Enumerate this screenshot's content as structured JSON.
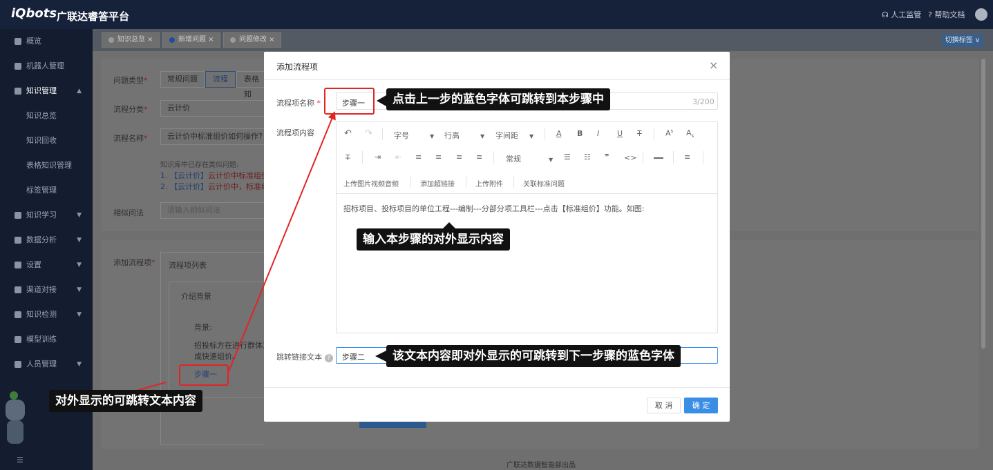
{
  "header": {
    "logo": "iQbots",
    "title": "广联达睿答平台",
    "monitor": "人工监管",
    "help": "帮助文档"
  },
  "sidebar": {
    "items": [
      {
        "label": "概览"
      },
      {
        "label": "机器人管理"
      },
      {
        "label": "知识管理"
      },
      {
        "label": "知识总览"
      },
      {
        "label": "知识回收"
      },
      {
        "label": "表格知识管理"
      },
      {
        "label": "标签管理"
      },
      {
        "label": "知识学习"
      },
      {
        "label": "数据分析"
      },
      {
        "label": "设置"
      },
      {
        "label": "渠道对接"
      },
      {
        "label": "知识检测"
      },
      {
        "label": "模型训练"
      },
      {
        "label": "人员管理"
      }
    ]
  },
  "tabs": [
    {
      "label": "知识总览"
    },
    {
      "label": "新增问题"
    },
    {
      "label": "问题修改"
    }
  ],
  "switch_tab": "切换标签",
  "form": {
    "type_label": "问题类型",
    "type_options": [
      "常规问题",
      "流程",
      "表格知"
    ],
    "category_label": "流程分类",
    "category_value": "云计价",
    "name_label": "流程名称",
    "name_value": "云计价中标准组价如何操作?",
    "existing_note": "知识库中已存在类似问题:",
    "existing_1_prefix": "1. 【云计价】",
    "existing_1_text": "云计价中标准组价",
    "existing_2_prefix": "2. 【云计价】",
    "existing_2_text": "云计价中，标准组",
    "similar_label": "相似问法",
    "similar_placeholder": "请输入相似问法",
    "add_flow_label": "添加流程项",
    "flow_list_label": "流程项列表",
    "intro_title": "介绍背景",
    "bg_label": "背景:",
    "bg_text_1": "招投标方在进行群体工",
    "bg_text_2": "成快速组价。",
    "step_link": "步骤一"
  },
  "footer_text": "广联达数据智能部出品",
  "modal": {
    "title": "添加流程项",
    "item_name_label": "流程项名称",
    "item_name_value": "步骤一",
    "counter": "3/200",
    "content_label": "流程项内容",
    "toolbar_row1": [
      "字号",
      "行高",
      "字间距"
    ],
    "toolbar_normal": "常规",
    "toolbar_row3": [
      "上传图片视频音频",
      "添加超链接",
      "上传附件",
      "关联标准问题"
    ],
    "content_text": "招标项目、投标项目的单位工程---编制---分部分项工具栏---点击【标准组价】功能。如图:",
    "jump_label": "跳转链接文本",
    "jump_value": "步骤二",
    "cancel": "取 消",
    "confirm": "确 定"
  },
  "callouts": {
    "c1": "点击上一步的蓝色字体可跳转到本步骤中",
    "c2": "输入本步骤的对外显示内容",
    "c3": "该文本内容即对外显示的可跳转到下一步骤的蓝色字体",
    "c4": "对外显示的可跳转文本内容"
  },
  "colors": {
    "accent": "#3a8ee6",
    "annotation_red": "#e02525",
    "sidebar": "#141d30"
  }
}
